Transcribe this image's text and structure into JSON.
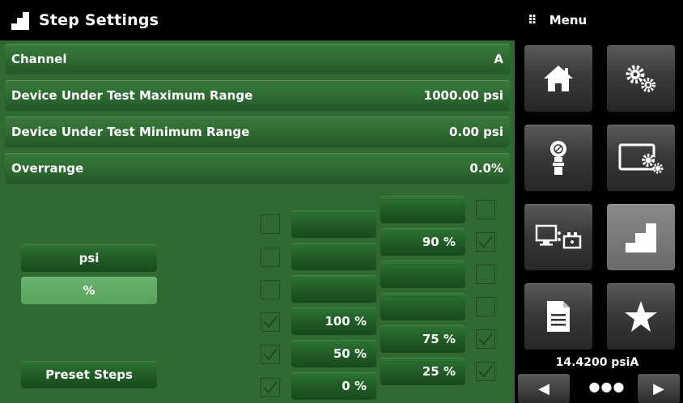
{
  "header": {
    "title": "Step Settings",
    "icon": "step-settings-icon"
  },
  "menu_header": {
    "dots": "⠿",
    "title": "Menu"
  },
  "settings_rows": [
    {
      "label": "Channel",
      "value": "A"
    },
    {
      "label": "Device Under Test Maximum Range",
      "value": "1000.00 psi"
    },
    {
      "label": "Device Under Test Minimum Range",
      "value": "0.00 psi"
    },
    {
      "label": "Overrange",
      "value": "0.0%"
    }
  ],
  "units": {
    "psi": "psi",
    "percent": "%",
    "selected": "%"
  },
  "preset_steps_label": "Preset Steps",
  "steps_left": [
    {
      "label": "",
      "checked": false
    },
    {
      "label": "",
      "checked": false
    },
    {
      "label": "",
      "checked": false
    },
    {
      "label": "100 %",
      "checked": true
    },
    {
      "label": "50 %",
      "checked": true
    },
    {
      "label": "0 %",
      "checked": true
    }
  ],
  "steps_right": [
    {
      "label": "",
      "checked": false
    },
    {
      "label": "90 %",
      "checked": true
    },
    {
      "label": "",
      "checked": false
    },
    {
      "label": "",
      "checked": false
    },
    {
      "label": "75 %",
      "checked": true
    },
    {
      "label": "25 %",
      "checked": true
    }
  ],
  "menu_tiles": [
    "home-icon",
    "settings-gears-icon",
    "sensor-icon",
    "display-settings-icon",
    "remote-communication-icon",
    "step-settings-icon",
    "document-icon",
    "favorites-star-icon"
  ],
  "status": {
    "pressure": "14.4200 psiA"
  },
  "nav": {
    "prev": "◀",
    "pager": "●●●",
    "next": "▶"
  }
}
